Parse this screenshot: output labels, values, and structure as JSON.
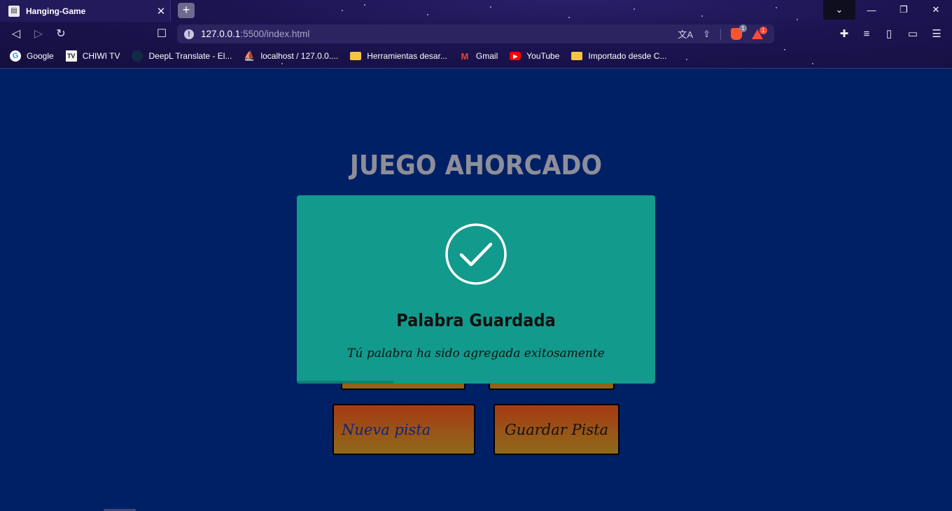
{
  "browser": {
    "tab_title": "Hanging-Game",
    "new_tab": "+",
    "url_host": "127.0.0.1",
    "url_rest": ":5500/index.html",
    "brave_count": "1",
    "rewards_count": "1"
  },
  "bookmarks": [
    {
      "label": "Google",
      "icon": "google-icon"
    },
    {
      "label": "CHIWI TV",
      "icon": "tv-icon"
    },
    {
      "label": "DeepL Translate - El...",
      "icon": "deepl-icon"
    },
    {
      "label": "localhost / 127.0.0....",
      "icon": "phpmyadmin-icon"
    },
    {
      "label": "Herramientas desar...",
      "icon": "folder-icon"
    },
    {
      "label": "Gmail",
      "icon": "gmail-icon"
    },
    {
      "label": "YouTube",
      "icon": "youtube-icon"
    },
    {
      "label": "Importado desde C...",
      "icon": "folder-icon"
    }
  ],
  "page": {
    "title": "JUEGO AHORCADO",
    "new_hint_label": "Nueva pista",
    "save_hint_label": "Guardar Pista"
  },
  "toast": {
    "title": "Palabra Guardada",
    "message": "Tú palabra ha sido agregada exitosamente",
    "progress_fraction": 0.27
  },
  "colors": {
    "page_background": "#002066",
    "toast_background": "#129a8c",
    "title_color": "#8e8e99"
  }
}
